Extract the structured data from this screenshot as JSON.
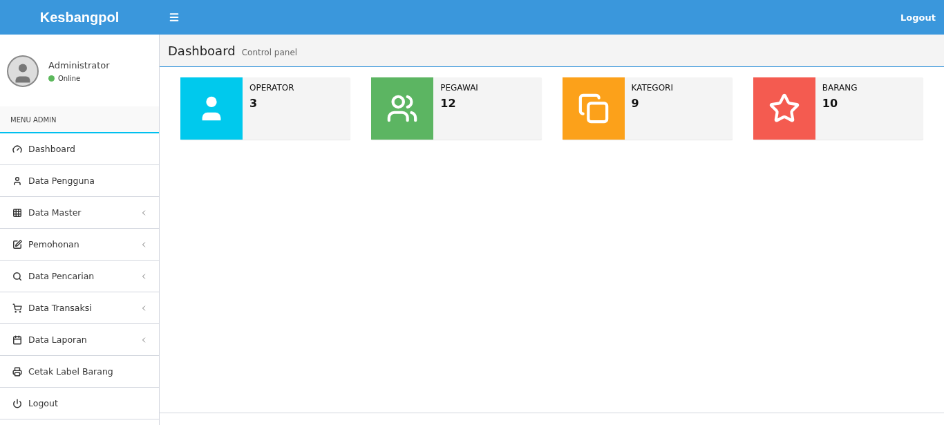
{
  "header": {
    "brand": "Kesbangpol",
    "logout": "Logout"
  },
  "user": {
    "name": "Administrator",
    "status": "Online",
    "online": true
  },
  "menu": {
    "title": "MENU ADMIN",
    "items": [
      {
        "label": "Dashboard",
        "kind": "dashboard",
        "expandable": false
      },
      {
        "label": "Data Pengguna",
        "kind": "user",
        "expandable": false
      },
      {
        "label": "Data Master",
        "kind": "grid",
        "expandable": true
      },
      {
        "label": "Pemohonan",
        "kind": "edit",
        "expandable": true
      },
      {
        "label": "Data Pencarian",
        "kind": "search",
        "expandable": true
      },
      {
        "label": "Data Transaksi",
        "kind": "cart",
        "expandable": true
      },
      {
        "label": "Data Laporan",
        "kind": "calendar",
        "expandable": true
      },
      {
        "label": "Cetak Label Barang",
        "kind": "print",
        "expandable": false
      },
      {
        "label": "Logout",
        "kind": "power",
        "expandable": false
      }
    ]
  },
  "page": {
    "title": "Dashboard",
    "subtitle": "Control panel"
  },
  "info_boxes": [
    {
      "label": "OPERATOR",
      "value": "3",
      "kind": "user",
      "color": "#00c9ed"
    },
    {
      "label": "PEGAWAI",
      "value": "12",
      "kind": "users",
      "color": "#5cb562"
    },
    {
      "label": "KATEGORI",
      "value": "9",
      "kind": "copy",
      "color": "#fca11a"
    },
    {
      "label": "BARANG",
      "value": "10",
      "kind": "star",
      "color": "#f45b50"
    }
  ]
}
